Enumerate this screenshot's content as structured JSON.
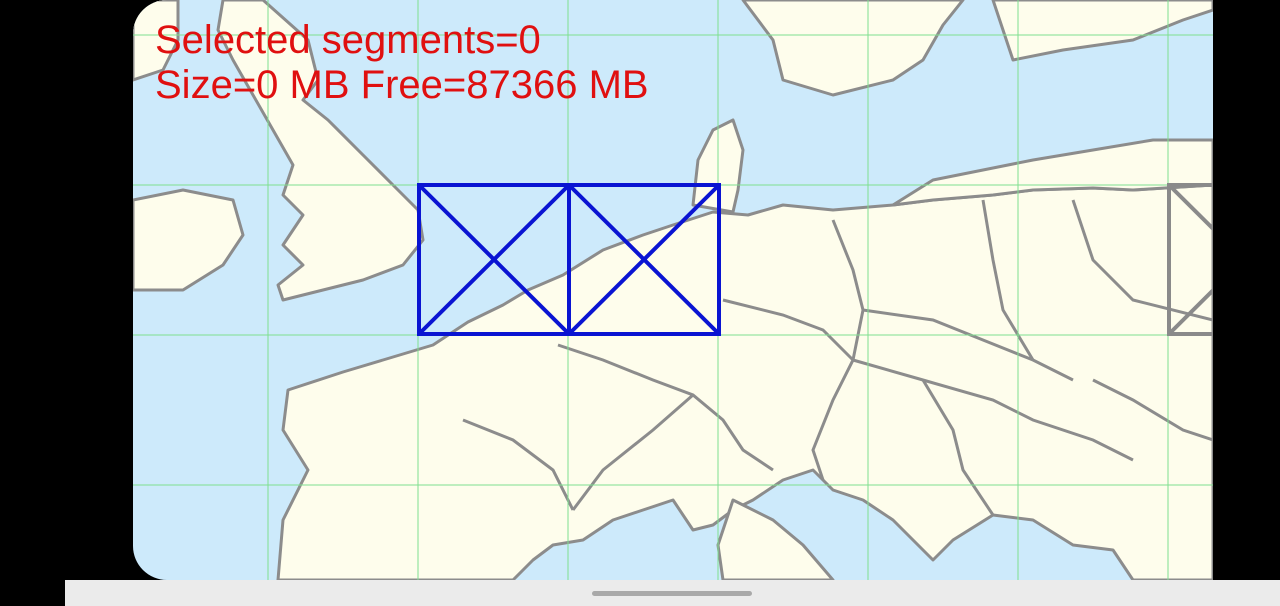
{
  "overlay": {
    "selected_line": "Selected segments=0",
    "size_line": "Size=0 MB Free=87366 MB"
  },
  "colors": {
    "water": "#cdeafb",
    "land": "#fefdec",
    "border": "#8c8c8c",
    "grid": "#7fe08f",
    "available_segment": "#0a14d2",
    "unavailable_segment": "#8a8a8a",
    "overlay_text": "#e01010",
    "nav_bar": "#ebebeb"
  },
  "icons": {
    "home_indicator": "home-indicator-icon"
  }
}
